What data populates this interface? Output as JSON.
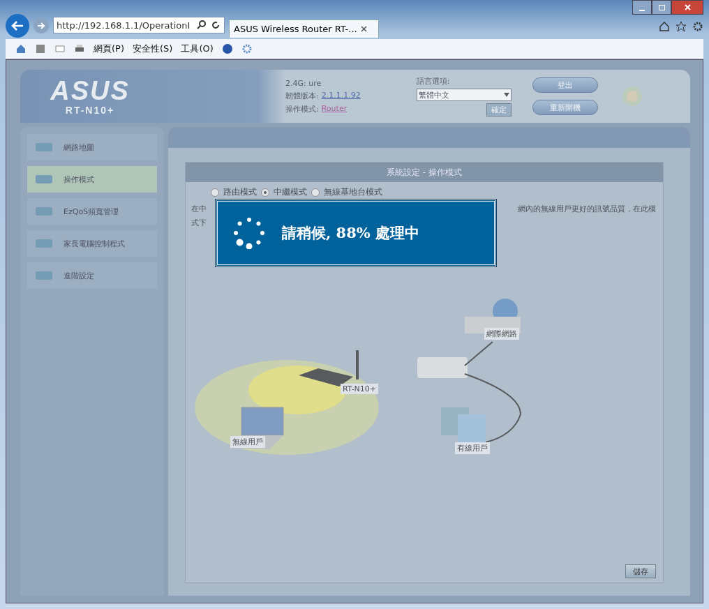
{
  "browser": {
    "url": "http://192.168.1.1/OperationI",
    "tab": {
      "title": "ASUS Wireless Router RT-...",
      "selected": true
    },
    "menus": [
      "網頁(P)",
      "安全性(S)",
      "工具(O)"
    ]
  },
  "header": {
    "logo": "ASUS",
    "model": "RT-N10+",
    "ssid_label": "2.4G:",
    "ssid": "ure",
    "firmware_label": "韌體版本:",
    "firmware": "2.1.1.1.92",
    "mode_label": "操作模式:",
    "mode": "Router",
    "language_label": "語言選項:",
    "language": "繁體中文",
    "apply": "確定",
    "logout": "登出",
    "reboot": "重新開機"
  },
  "sidebar": {
    "items": [
      {
        "label": "網路地圖",
        "selected": false
      },
      {
        "label": "操作模式",
        "selected": true
      },
      {
        "label": "EzQoS頻寬管理",
        "selected": false
      },
      {
        "label": "家長電腦控制程式",
        "selected": false
      },
      {
        "label": "進階設定",
        "selected": false
      }
    ]
  },
  "panel": {
    "title": "系統設定 - 操作模式",
    "modes": [
      {
        "label": "路由模式",
        "selected": false
      },
      {
        "label": "中繼模式",
        "selected": true
      },
      {
        "label": "無線基地台模式",
        "selected": false
      }
    ],
    "description_left": [
      "在中",
      "式下"
    ],
    "description_right": "網內的無線用戶更好的訊號品質，在此模",
    "diagram": {
      "internet": "網際網路",
      "router": "RT-N10+",
      "wireless": "無線用戶",
      "wired": "有線用戶"
    },
    "save": "儲存"
  },
  "loading": {
    "message": "請稍候, 88% 處理中"
  }
}
